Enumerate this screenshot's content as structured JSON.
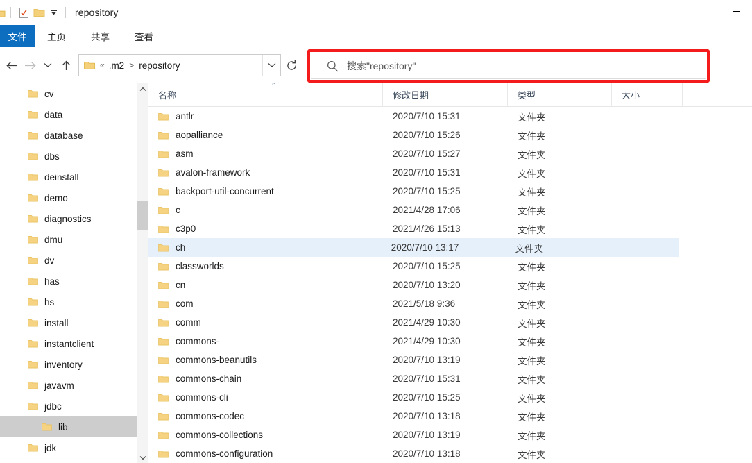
{
  "window": {
    "title": "repository",
    "minimize_label": "—"
  },
  "quick_access": {
    "items": [
      {
        "name": "folder-icon",
        "label": ""
      },
      {
        "name": "properties-icon",
        "label": ""
      },
      {
        "name": "new-folder-icon",
        "label": ""
      },
      {
        "name": "customize-chevron-icon",
        "label": "▾"
      }
    ]
  },
  "ribbon": {
    "tabs": [
      {
        "label": "文件",
        "active": true
      },
      {
        "label": "主页",
        "active": false
      },
      {
        "label": "共享",
        "active": false
      },
      {
        "label": "查看",
        "active": false
      }
    ],
    "active_tab_bg": "#0d6ec0"
  },
  "nav": {
    "back_label": "←",
    "forward_label": "→",
    "history_label": "⌄",
    "up_label": "↑",
    "refresh_label": "↻",
    "overflow_label": "«",
    "breadcrumb": [
      ".m2",
      "repository"
    ],
    "breadcrumb_sep": ">",
    "dropdown_label": "⌄"
  },
  "search": {
    "placeholder": "搜索\"repository\"",
    "icon": "search-icon",
    "highlight_color": "#f31b1b"
  },
  "sidebar": {
    "selected": "lib",
    "items": [
      {
        "label": "cv",
        "child": false
      },
      {
        "label": "data",
        "child": false
      },
      {
        "label": "database",
        "child": false
      },
      {
        "label": "dbs",
        "child": false
      },
      {
        "label": "deinstall",
        "child": false
      },
      {
        "label": "demo",
        "child": false
      },
      {
        "label": "diagnostics",
        "child": false
      },
      {
        "label": "dmu",
        "child": false
      },
      {
        "label": "dv",
        "child": false
      },
      {
        "label": "has",
        "child": false
      },
      {
        "label": "hs",
        "child": false
      },
      {
        "label": "install",
        "child": false
      },
      {
        "label": "instantclient",
        "child": false
      },
      {
        "label": "inventory",
        "child": false
      },
      {
        "label": "javavm",
        "child": false
      },
      {
        "label": "jdbc",
        "child": false
      },
      {
        "label": "lib",
        "child": true
      },
      {
        "label": "jdk",
        "child": false
      }
    ],
    "scroll_up": "⌃",
    "scroll_down": "⌄"
  },
  "filelist": {
    "columns": [
      {
        "label": "名称",
        "key": "name"
      },
      {
        "label": "修改日期",
        "key": "date"
      },
      {
        "label": "类型",
        "key": "type"
      },
      {
        "label": "大小",
        "key": "size"
      }
    ],
    "sort_caret": "⌃",
    "highlighted_row": "ch",
    "highlight_color": "#e6f0fb",
    "rows": [
      {
        "name": "antlr",
        "date": "2020/7/10 15:31",
        "type": "文件夹",
        "size": ""
      },
      {
        "name": "aopalliance",
        "date": "2020/7/10 15:26",
        "type": "文件夹",
        "size": ""
      },
      {
        "name": "asm",
        "date": "2020/7/10 15:27",
        "type": "文件夹",
        "size": ""
      },
      {
        "name": "avalon-framework",
        "date": "2020/7/10 15:31",
        "type": "文件夹",
        "size": ""
      },
      {
        "name": "backport-util-concurrent",
        "date": "2020/7/10 15:25",
        "type": "文件夹",
        "size": ""
      },
      {
        "name": "c",
        "date": "2021/4/28 17:06",
        "type": "文件夹",
        "size": ""
      },
      {
        "name": "c3p0",
        "date": "2021/4/26 15:13",
        "type": "文件夹",
        "size": ""
      },
      {
        "name": "ch",
        "date": "2020/7/10 13:17",
        "type": "文件夹",
        "size": ""
      },
      {
        "name": "classworlds",
        "date": "2020/7/10 15:25",
        "type": "文件夹",
        "size": ""
      },
      {
        "name": "cn",
        "date": "2020/7/10 13:20",
        "type": "文件夹",
        "size": ""
      },
      {
        "name": "com",
        "date": "2021/5/18 9:36",
        "type": "文件夹",
        "size": ""
      },
      {
        "name": "comm",
        "date": "2021/4/29 10:30",
        "type": "文件夹",
        "size": ""
      },
      {
        "name": "commons-",
        "date": "2021/4/29 10:30",
        "type": "文件夹",
        "size": ""
      },
      {
        "name": "commons-beanutils",
        "date": "2020/7/10 13:19",
        "type": "文件夹",
        "size": ""
      },
      {
        "name": "commons-chain",
        "date": "2020/7/10 15:31",
        "type": "文件夹",
        "size": ""
      },
      {
        "name": "commons-cli",
        "date": "2020/7/10 15:25",
        "type": "文件夹",
        "size": ""
      },
      {
        "name": "commons-codec",
        "date": "2020/7/10 13:18",
        "type": "文件夹",
        "size": ""
      },
      {
        "name": "commons-collections",
        "date": "2020/7/10 13:19",
        "type": "文件夹",
        "size": ""
      },
      {
        "name": "commons-configuration",
        "date": "2020/7/10 13:18",
        "type": "文件夹",
        "size": ""
      }
    ]
  }
}
